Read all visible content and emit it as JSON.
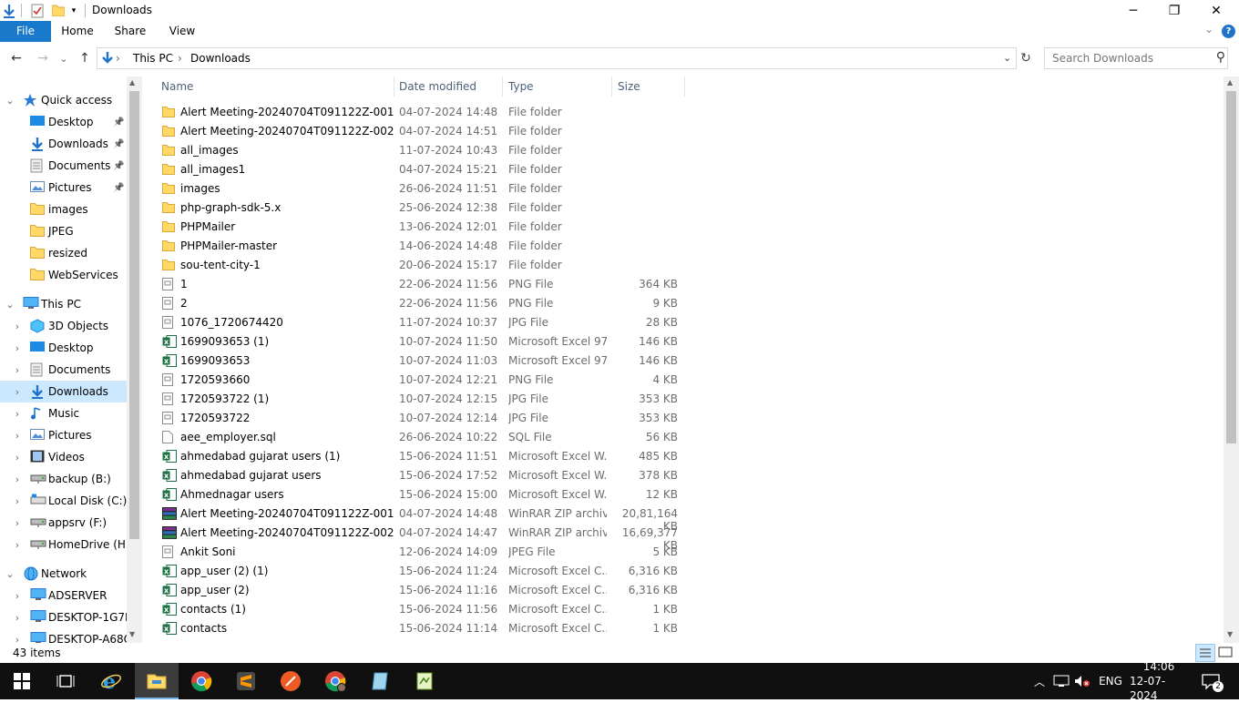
{
  "window": {
    "title": "Downloads",
    "minimize_glyph": "─",
    "maximize_glyph": "❐",
    "close_glyph": "✕"
  },
  "ribbon": {
    "tabs": [
      "File",
      "Home",
      "Share",
      "View"
    ],
    "help_glyph": "?",
    "collapse_glyph": "⌄"
  },
  "address": {
    "back_glyph": "←",
    "forward_glyph": "→",
    "recent_glyph": "⌄",
    "up_glyph": "↑",
    "crumbs": [
      "This PC",
      "Downloads"
    ],
    "separator": "›",
    "dropdown_glyph": "⌄",
    "refresh_glyph": "↻"
  },
  "search": {
    "placeholder": "Search Downloads",
    "icon_glyph": "⚲"
  },
  "nav": {
    "items": [
      {
        "label": "Quick access",
        "icon": "star-icon",
        "level": 0,
        "chevron": "⌄",
        "pinned": false
      },
      {
        "label": "Desktop",
        "icon": "desktop-icon",
        "level": 1,
        "chevron": "",
        "pinned": true
      },
      {
        "label": "Downloads",
        "icon": "download-icon",
        "level": 1,
        "chevron": "",
        "pinned": true
      },
      {
        "label": "Documents",
        "icon": "documents-icon",
        "level": 1,
        "chevron": "",
        "pinned": true
      },
      {
        "label": "Pictures",
        "icon": "pictures-icon",
        "level": 1,
        "chevron": "",
        "pinned": true
      },
      {
        "label": "images",
        "icon": "folder-icon",
        "level": 1,
        "chevron": "",
        "pinned": false
      },
      {
        "label": "JPEG",
        "icon": "folder-icon",
        "level": 1,
        "chevron": "",
        "pinned": false
      },
      {
        "label": "resized",
        "icon": "folder-icon",
        "level": 1,
        "chevron": "",
        "pinned": false
      },
      {
        "label": "WebServices",
        "icon": "folder-icon",
        "level": 1,
        "chevron": "",
        "pinned": false
      },
      {
        "label": "This PC",
        "icon": "computer-icon",
        "level": 0,
        "chevron": "⌄",
        "pinned": false,
        "gap": true
      },
      {
        "label": "3D Objects",
        "icon": "cube-icon",
        "level": 1,
        "chevron": "›",
        "pinned": false
      },
      {
        "label": "Desktop",
        "icon": "desktop-icon",
        "level": 1,
        "chevron": "›",
        "pinned": false
      },
      {
        "label": "Documents",
        "icon": "documents-icon",
        "level": 1,
        "chevron": "›",
        "pinned": false
      },
      {
        "label": "Downloads",
        "icon": "download-icon",
        "level": 1,
        "chevron": "›",
        "pinned": false,
        "selected": true
      },
      {
        "label": "Music",
        "icon": "music-icon",
        "level": 1,
        "chevron": "›",
        "pinned": false
      },
      {
        "label": "Pictures",
        "icon": "pictures-icon",
        "level": 1,
        "chevron": "›",
        "pinned": false
      },
      {
        "label": "Videos",
        "icon": "videos-icon",
        "level": 1,
        "chevron": "›",
        "pinned": false
      },
      {
        "label": "backup (B:)",
        "icon": "network-drive-icon",
        "level": 1,
        "chevron": "›",
        "pinned": false
      },
      {
        "label": "Local Disk (C:)",
        "icon": "disk-icon",
        "level": 1,
        "chevron": "›",
        "pinned": false
      },
      {
        "label": "appsrv (F:)",
        "icon": "network-drive-icon",
        "level": 1,
        "chevron": "›",
        "pinned": false
      },
      {
        "label": "HomeDrive (H:)",
        "icon": "network-drive-icon",
        "level": 1,
        "chevron": "›",
        "pinned": false
      },
      {
        "label": "Network",
        "icon": "network-icon",
        "level": 0,
        "chevron": "⌄",
        "pinned": false,
        "gap": true
      },
      {
        "label": "ADSERVER",
        "icon": "computer-icon",
        "level": 1,
        "chevron": "›",
        "pinned": false
      },
      {
        "label": "DESKTOP-1G7DI",
        "icon": "computer-icon",
        "level": 1,
        "chevron": "›",
        "pinned": false
      },
      {
        "label": "DESKTOP-A68OI",
        "icon": "computer-icon",
        "level": 1,
        "chevron": "›",
        "pinned": false
      }
    ]
  },
  "columns": {
    "name": "Name",
    "date": "Date modified",
    "type": "Type",
    "size": "Size",
    "sort_glyph": "^"
  },
  "files": [
    {
      "name": "Alert Meeting-20240704T091122Z-001",
      "date": "04-07-2024 14:48",
      "type": "File folder",
      "size": "",
      "icon": "folder"
    },
    {
      "name": "Alert Meeting-20240704T091122Z-002",
      "date": "04-07-2024 14:51",
      "type": "File folder",
      "size": "",
      "icon": "folder"
    },
    {
      "name": "all_images",
      "date": "11-07-2024 10:43",
      "type": "File folder",
      "size": "",
      "icon": "folder"
    },
    {
      "name": "all_images1",
      "date": "04-07-2024 15:21",
      "type": "File folder",
      "size": "",
      "icon": "folder"
    },
    {
      "name": "images",
      "date": "26-06-2024 11:51",
      "type": "File folder",
      "size": "",
      "icon": "folder"
    },
    {
      "name": "php-graph-sdk-5.x",
      "date": "25-06-2024 12:38",
      "type": "File folder",
      "size": "",
      "icon": "folder"
    },
    {
      "name": "PHPMailer",
      "date": "13-06-2024 12:01",
      "type": "File folder",
      "size": "",
      "icon": "folder"
    },
    {
      "name": "PHPMailer-master",
      "date": "14-06-2024 14:48",
      "type": "File folder",
      "size": "",
      "icon": "folder"
    },
    {
      "name": "sou-tent-city-1",
      "date": "20-06-2024 15:17",
      "type": "File folder",
      "size": "",
      "icon": "folder"
    },
    {
      "name": "1",
      "date": "22-06-2024 11:56",
      "type": "PNG File",
      "size": "364 KB",
      "icon": "image"
    },
    {
      "name": "2",
      "date": "22-06-2024 11:56",
      "type": "PNG File",
      "size": "9 KB",
      "icon": "image"
    },
    {
      "name": "1076_1720674420",
      "date": "11-07-2024 10:37",
      "type": "JPG File",
      "size": "28 KB",
      "icon": "image"
    },
    {
      "name": "1699093653 (1)",
      "date": "10-07-2024 11:50",
      "type": "Microsoft Excel 97...",
      "size": "146 KB",
      "icon": "excel"
    },
    {
      "name": "1699093653",
      "date": "10-07-2024 11:03",
      "type": "Microsoft Excel 97...",
      "size": "146 KB",
      "icon": "excel"
    },
    {
      "name": "1720593660",
      "date": "10-07-2024 12:21",
      "type": "PNG File",
      "size": "4 KB",
      "icon": "image"
    },
    {
      "name": "1720593722 (1)",
      "date": "10-07-2024 12:15",
      "type": "JPG File",
      "size": "353 KB",
      "icon": "image"
    },
    {
      "name": "1720593722",
      "date": "10-07-2024 12:14",
      "type": "JPG File",
      "size": "353 KB",
      "icon": "image"
    },
    {
      "name": "aee_employer.sql",
      "date": "26-06-2024 10:22",
      "type": "SQL File",
      "size": "56 KB",
      "icon": "sql"
    },
    {
      "name": "ahmedabad gujarat users (1)",
      "date": "15-06-2024 11:51",
      "type": "Microsoft Excel W...",
      "size": "485 KB",
      "icon": "excel"
    },
    {
      "name": "ahmedabad gujarat users",
      "date": "15-06-2024 17:52",
      "type": "Microsoft Excel W...",
      "size": "378 KB",
      "icon": "excel"
    },
    {
      "name": "Ahmednagar users",
      "date": "15-06-2024 15:00",
      "type": "Microsoft Excel W...",
      "size": "12 KB",
      "icon": "excel"
    },
    {
      "name": "Alert Meeting-20240704T091122Z-001",
      "date": "04-07-2024 14:48",
      "type": "WinRAR ZIP archive",
      "size": "20,81,164 KB",
      "icon": "zip"
    },
    {
      "name": "Alert Meeting-20240704T091122Z-002",
      "date": "04-07-2024 14:47",
      "type": "WinRAR ZIP archive",
      "size": "16,69,377 KB",
      "icon": "zip"
    },
    {
      "name": "Ankit Soni",
      "date": "12-06-2024 14:09",
      "type": "JPEG File",
      "size": "5 KB",
      "icon": "image"
    },
    {
      "name": "app_user (2) (1)",
      "date": "15-06-2024 11:24",
      "type": "Microsoft Excel C...",
      "size": "6,316 KB",
      "icon": "excel"
    },
    {
      "name": "app_user (2)",
      "date": "15-06-2024 11:16",
      "type": "Microsoft Excel C...",
      "size": "6,316 KB",
      "icon": "excel"
    },
    {
      "name": "contacts (1)",
      "date": "15-06-2024 11:56",
      "type": "Microsoft Excel C...",
      "size": "1 KB",
      "icon": "excel"
    },
    {
      "name": "contacts",
      "date": "15-06-2024 11:14",
      "type": "Microsoft Excel C...",
      "size": "1 KB",
      "icon": "excel"
    }
  ],
  "status": {
    "item_count": "43 items"
  },
  "taskbar": {
    "apps": [
      "start-icon",
      "task-view-icon",
      "internet-explorer-icon",
      "file-explorer-icon",
      "chrome-icon",
      "sublime-text-icon",
      "postman-icon",
      "chrome-profile-icon",
      "notepad-icon",
      "notepad-plus-icon"
    ],
    "language": "ENG",
    "time": "14:06",
    "date": "12-07-2024",
    "notifications": "2"
  }
}
